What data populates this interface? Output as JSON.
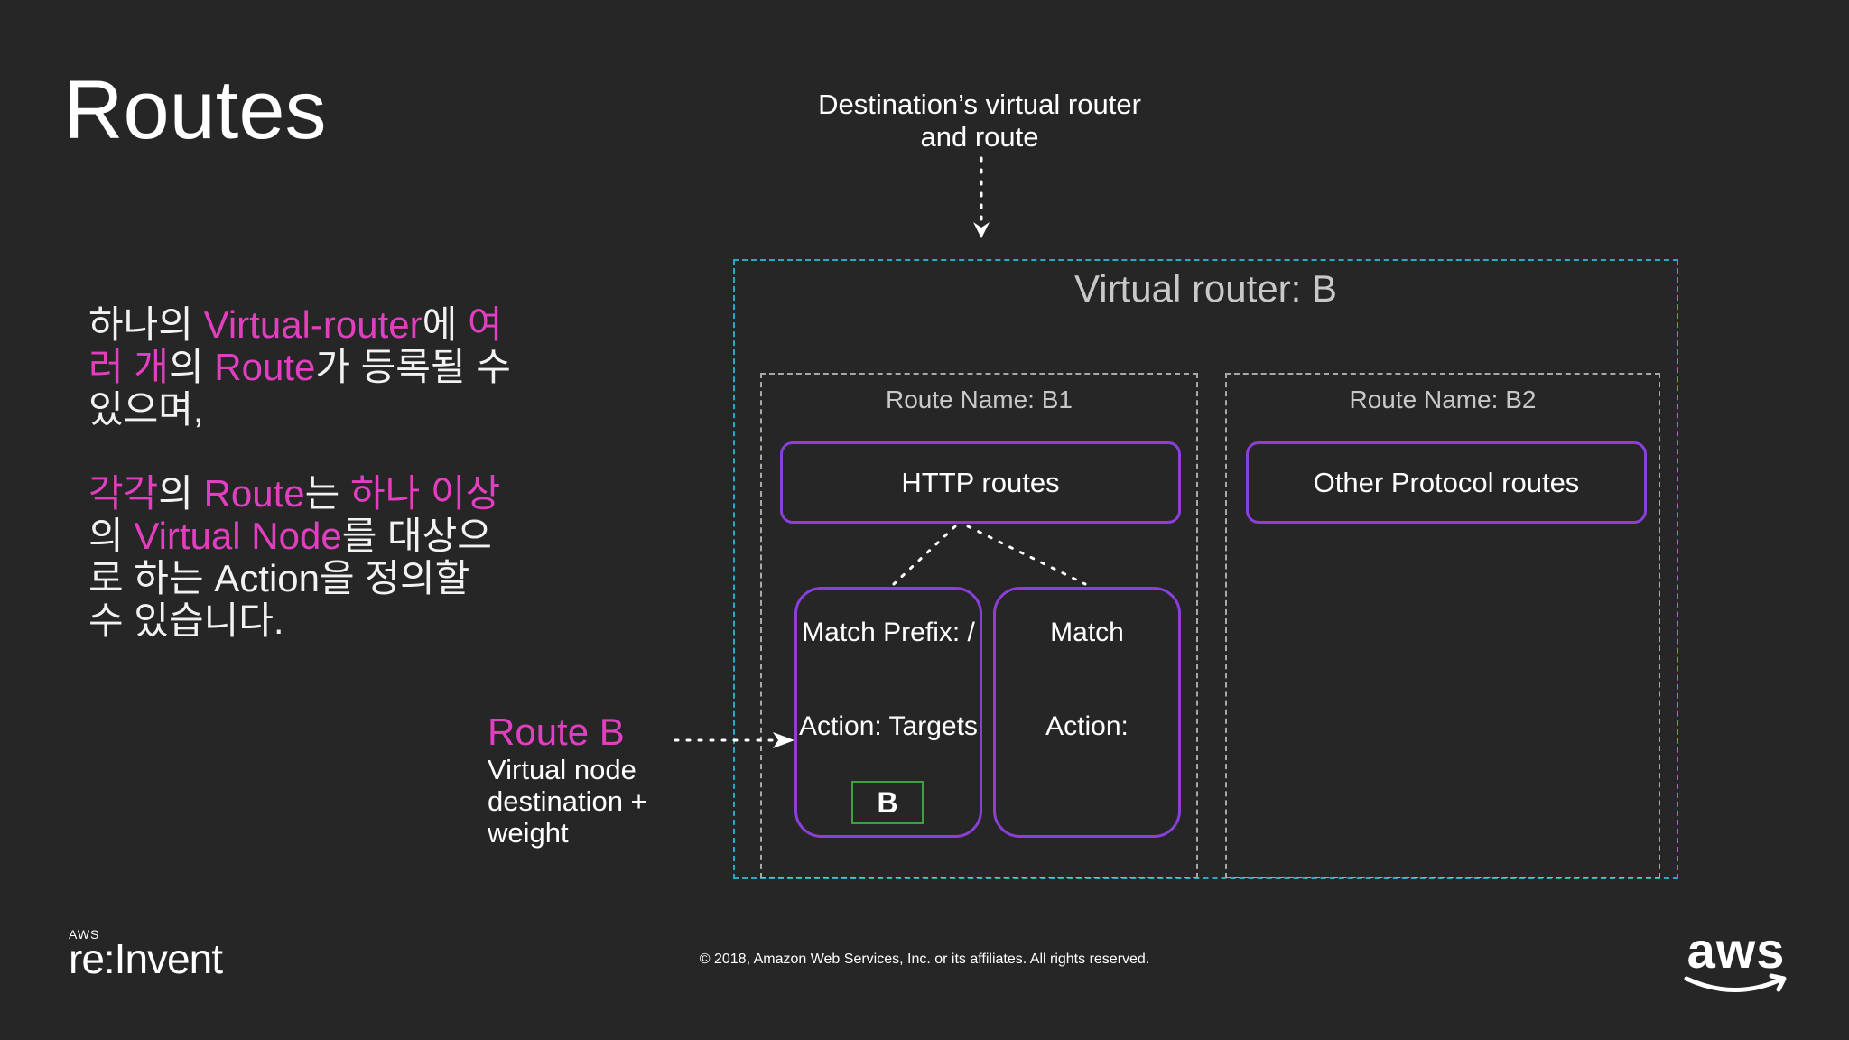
{
  "slide": {
    "title": "Routes",
    "left_text": {
      "p1": [
        {
          "text": "하나의 ",
          "hl": false
        },
        {
          "text": "Virtual-router",
          "hl": true
        },
        {
          "text": "에 ",
          "hl": false
        },
        {
          "text": "여러 개",
          "hl": true
        },
        {
          "text": "의 ",
          "hl": false
        },
        {
          "text": "Route",
          "hl": true
        },
        {
          "text": "가 등록될 수 있으며,",
          "hl": false
        }
      ],
      "p2": [
        {
          "text": "각각",
          "hl": true
        },
        {
          "text": "의 ",
          "hl": false
        },
        {
          "text": "Route",
          "hl": true
        },
        {
          "text": "는 ",
          "hl": false
        },
        {
          "text": "하나 이상",
          "hl": true
        },
        {
          "text": "의 ",
          "hl": false
        },
        {
          "text": "Virtual Node",
          "hl": true
        },
        {
          "text": "를 대상으로 하는 Action을 정의할 수 있습니다.",
          "hl": false
        }
      ]
    }
  },
  "diagram": {
    "destination_label": "Destination’s virtual router and route",
    "router_title": "Virtual router: B",
    "route_b1": {
      "name": "Route Name: B1",
      "protocol": "HTTP routes",
      "match_1": {
        "match": "Match Prefix: /",
        "action": "Action: Targets",
        "target": "B"
      },
      "match_2": {
        "match": "Match",
        "action": "Action:"
      }
    },
    "route_b2": {
      "name": "Route Name: B2",
      "protocol": "Other Protocol routes"
    },
    "route_b_callout": {
      "title": "Route B",
      "description": "Virtual node destination + weight"
    }
  },
  "footer": {
    "logo_small": "AWS",
    "logo_reinvent": "re:Invent",
    "copyright": "© 2018, Amazon Web Services, Inc. or its affiliates. All rights reserved.",
    "logo_aws": "aws"
  },
  "colors": {
    "background": "#262626",
    "highlight": "#e23fc0",
    "router_border": "#2ea7c4",
    "route_border": "#a8a8a8",
    "protocol_border": "#8b3fd9",
    "target_border": "#3fa03f",
    "aws_smile": "#ff9900"
  }
}
